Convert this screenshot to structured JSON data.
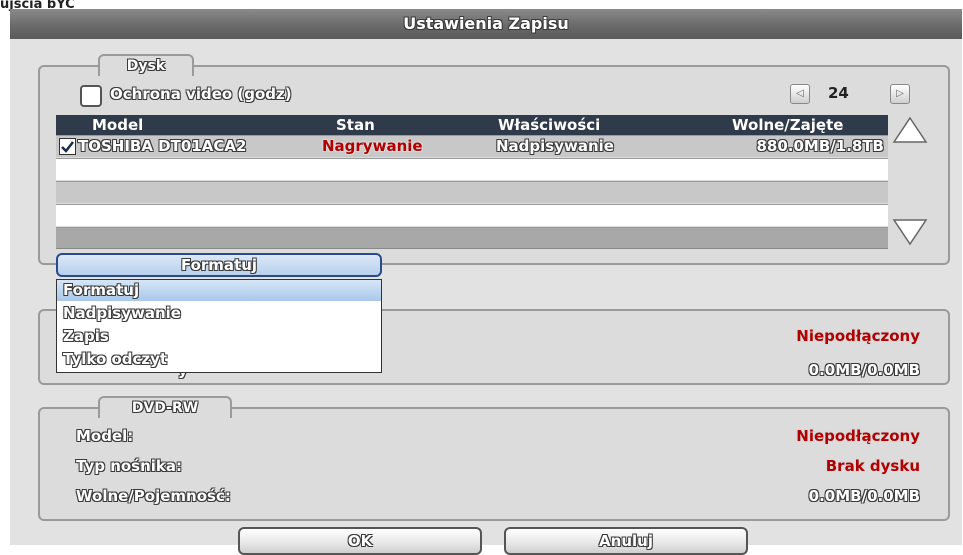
{
  "window": {
    "caption": "ujscia bYC",
    "title": "Ustawienia Zapisu"
  },
  "disk": {
    "group_title": "Dysk",
    "protection_label": "Ochrona video (godz)",
    "pager": "24",
    "columns": [
      "Model",
      "Stan",
      "Właściwości",
      "Wolne/Zajęte"
    ],
    "rows": [
      {
        "checked": true,
        "model": "TOSHIBA DT01ACA2",
        "status": "Nagrywanie",
        "property": "Nadpisywanie",
        "space": "880.0MB/1.8TB"
      },
      {
        "checked": false,
        "model": "",
        "status": "",
        "property": "",
        "space": ""
      },
      {
        "checked": false,
        "model": "",
        "status": "",
        "property": "",
        "space": ""
      },
      {
        "checked": false,
        "model": "",
        "status": "",
        "property": "",
        "space": ""
      },
      {
        "checked": false,
        "model": "",
        "status": "",
        "property": "",
        "space": ""
      }
    ],
    "format_button": "Formatuj"
  },
  "dropdown": {
    "options": [
      "Formatuj",
      "Nadpisywanie",
      "Zapis",
      "Tylko odczyt"
    ],
    "selected_index": 0
  },
  "middle": {
    "status_value": "Niepodłączony",
    "space_label_partial": "y",
    "space_value": "0.0MB/0.0MB"
  },
  "dvd": {
    "group_title": "DVD-RW",
    "model_label": "Model:",
    "model_value": "Niepodłączony",
    "media_label": "Typ nośnika:",
    "media_value": "Brak dysku",
    "capacity_label": "Wolne/Pojemność:",
    "capacity_value": "0.0MB/0.0MB"
  },
  "buttons": {
    "ok": "OK",
    "cancel": "Anuluj"
  },
  "colors": {
    "title_bar": "#6a6a6a",
    "table_header": "#2f3a4a",
    "status_red": "#b00000",
    "dropdown_highlight": "#a9c8ea"
  }
}
